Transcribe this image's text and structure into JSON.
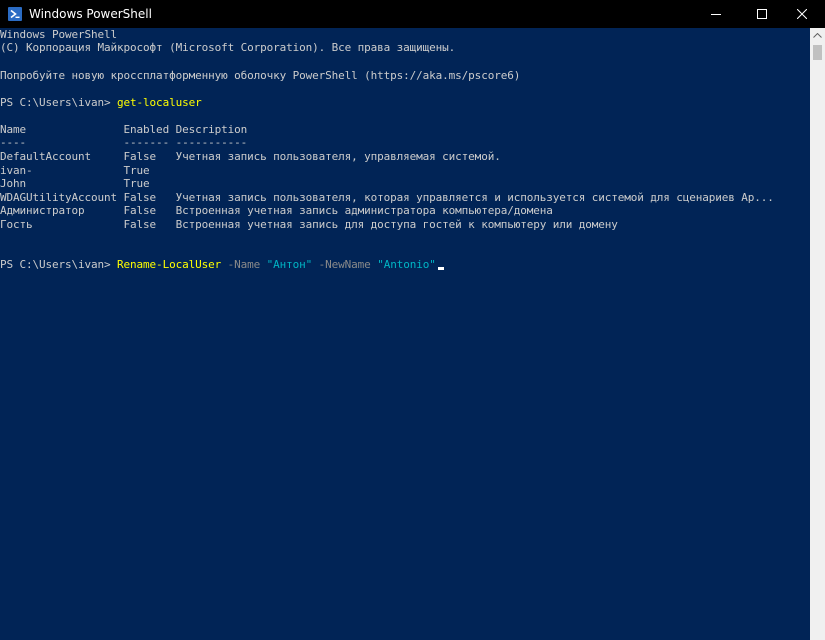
{
  "window": {
    "title": "Windows PowerShell",
    "icon": "powershell-icon",
    "controls": [
      "minimize-icon",
      "maximize-icon",
      "close-icon"
    ]
  },
  "colors": {
    "background": "#012456",
    "titlebar": "#000000",
    "text": "#cccccc",
    "command": "#ffff00",
    "parameter": "#8a8a8a",
    "string": "#00b4c4"
  },
  "console": {
    "header": [
      "Windows PowerShell",
      "(C) Корпорация Майкрософт (Microsoft Corporation). Все права защищены.",
      "Попробуйте новую кроссплатформенную оболочку PowerShell (https://aka.ms/pscore6)"
    ],
    "prompt": "PS C:\\Users\\ivan> ",
    "command1": "get-localuser",
    "table": {
      "header": "Name               Enabled Description",
      "separator": "----               ------- -----------",
      "rows": [
        "DefaultAccount     False   Учетная запись пользователя, управляемая системой.",
        "ivan-              True",
        "John               True",
        "WDAGUtilityAccount False   Учетная запись пользователя, которая управляется и используется системой для сценариев Ap...",
        "Администратор      False   Встроенная учетная запись администратора компьютера/домена",
        "Гость              False   Встроенная учетная запись для доступа гостей к компьютеру или домену"
      ]
    },
    "command2": {
      "cmdlet": "Rename-LocalUser",
      "param1": " -Name ",
      "value1": "\"Антон\"",
      "param2": " -NewName ",
      "value2": "\"Antonio\""
    }
  }
}
